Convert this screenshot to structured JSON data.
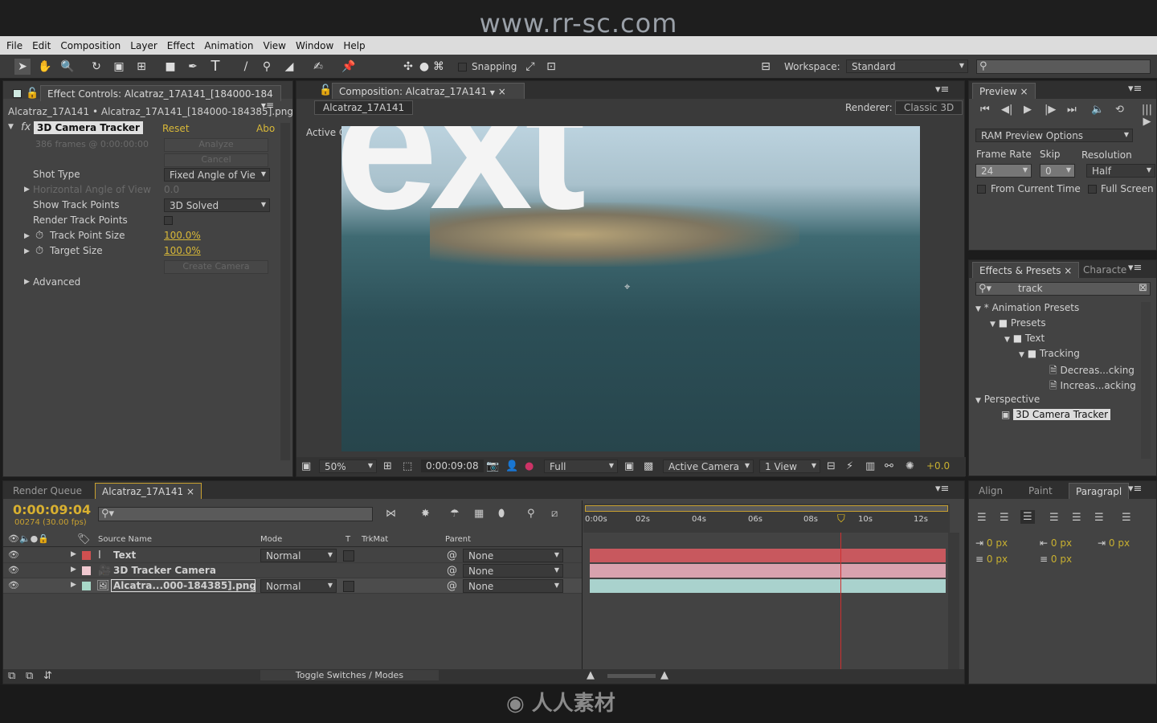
{
  "watermark": {
    "top": "www.rr-sc.com",
    "bottom": "人人素材",
    "faint": "人人素材 www.rr-sc.com"
  },
  "menu": [
    "File",
    "Edit",
    "Composition",
    "Layer",
    "Effect",
    "Animation",
    "View",
    "Window",
    "Help"
  ],
  "toolbar": {
    "snapping": "Snapping",
    "workspace_label": "Workspace:",
    "workspace": "Standard",
    "search_placeholder": ""
  },
  "effect_controls": {
    "tab": "Effect Controls: Alcatraz_17A141_[184000-184",
    "path": "Alcatraz_17A141 • Alcatraz_17A141_[184000-184385].png",
    "effect": "3D Camera Tracker",
    "reset": "Reset",
    "about": "Abo",
    "frames": "386 frames @ 0:00:00:00",
    "analyze": "Analyze",
    "cancel": "Cancel",
    "shot_type_label": "Shot Type",
    "shot_type": "Fixed Angle of Vie",
    "hav_label": "Horizontal Angle of View",
    "hav": "0.0",
    "show_tp_label": "Show Track Points",
    "show_tp": "3D Solved",
    "render_tp_label": "Render Track Points",
    "render_tp": false,
    "tps_label": "Track Point Size",
    "tps": "100.0%",
    "target_label": "Target Size",
    "target": "100.0%",
    "create_camera": "Create Camera",
    "advanced": "Advanced"
  },
  "composition": {
    "tab": "Composition: Alcatraz_17A141",
    "crumb": "Alcatraz_17A141",
    "renderer_label": "Renderer:",
    "renderer": "Classic 3D",
    "view_label": "Active Camera",
    "text_overlay": "ext",
    "zoom": "50%",
    "timecode": "0:00:09:08",
    "resolution": "Full",
    "camera": "Active Camera",
    "views": "1 View",
    "exposure": "+0.0"
  },
  "preview": {
    "tab": "Preview",
    "ram": "RAM Preview Options",
    "frame_rate_label": "Frame Rate",
    "frame_rate": "24",
    "skip_label": "Skip",
    "skip": "0",
    "resolution_label": "Resolution",
    "resolution": "Half",
    "from_current": "From Current Time",
    "full_screen": "Full Screen"
  },
  "effects_presets": {
    "tab": "Effects & Presets",
    "tab2": "Characte",
    "search": "track",
    "tree": [
      {
        "label": "* Animation Presets",
        "level": 0
      },
      {
        "label": "Presets",
        "level": 1
      },
      {
        "label": "Text",
        "level": 2
      },
      {
        "label": "Tracking",
        "level": 3
      },
      {
        "label": "Decreas...cking",
        "level": 4
      },
      {
        "label": "Increas...acking",
        "level": 4
      },
      {
        "label": "Perspective",
        "level": 0
      },
      {
        "label": "3D Camera Tracker",
        "level": 1
      }
    ]
  },
  "paragraph": {
    "tabs": [
      "Align",
      "Paint",
      "Paragrapl"
    ],
    "values": [
      "0 px",
      "0 px",
      "0 px",
      "0 px",
      "0 px"
    ]
  },
  "timeline": {
    "tab_rq": "Render Queue",
    "tab": "Alcatraz_17A141",
    "timecode": "0:00:09:04",
    "frame": "00274 (30.00 fps)",
    "cols": [
      "Source Name",
      "Mode",
      "T",
      "TrkMat",
      "Parent"
    ],
    "layers": [
      {
        "name": "Text",
        "color": "#d05050",
        "mode": "Normal",
        "parent": "None",
        "bar": "#c8585e"
      },
      {
        "name": "3D Tracker Camera",
        "color": "#f0c8d0",
        "mode": "",
        "parent": "None",
        "bar": "#d8a2ae"
      },
      {
        "name": "Alcatra...000-184385].png",
        "color": "#a8d8c8",
        "mode": "Normal",
        "parent": "None",
        "bar": "#a9d2cd"
      }
    ],
    "ruler": [
      "0:00s",
      "02s",
      "04s",
      "06s",
      "08s",
      "10s",
      "12s"
    ],
    "toggle": "Toggle Switches / Modes"
  }
}
